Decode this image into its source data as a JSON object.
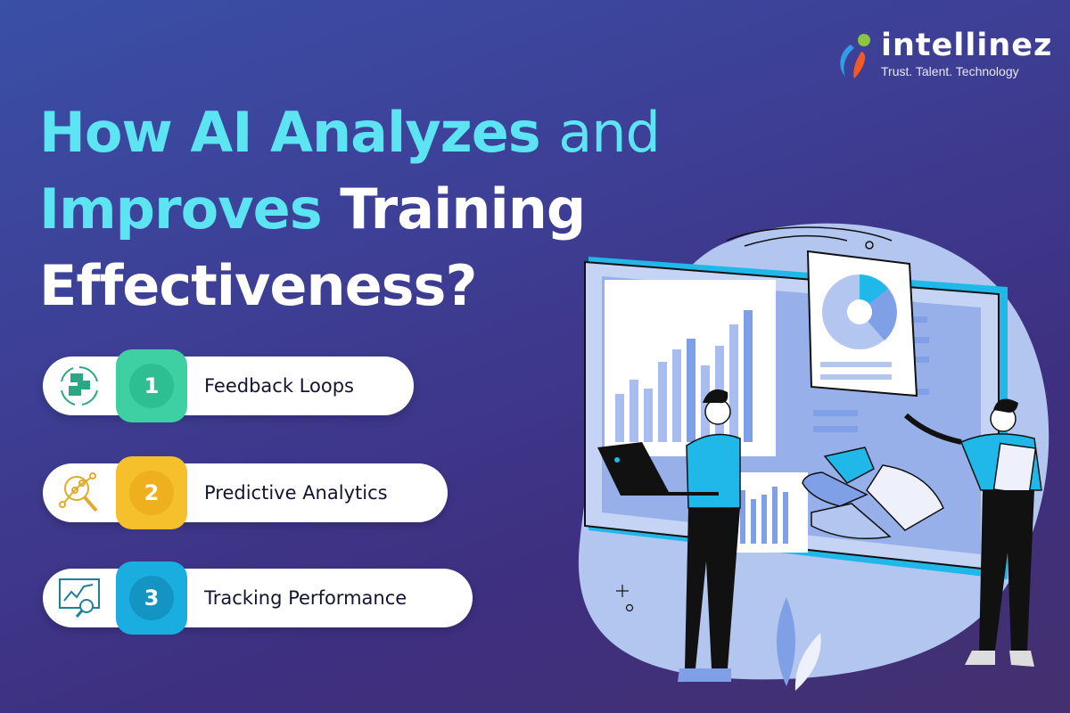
{
  "brand": {
    "name": "intellinez",
    "tagline": "Trust. Talent. Technology",
    "colors": {
      "blue": "#2e9ee6",
      "orange": "#f15a24",
      "green": "#8cc63f"
    }
  },
  "headline": {
    "line1_highlight": "How AI Analyzes",
    "line1_rest": "and",
    "line2_highlight": "Improves",
    "line2_rest": "Training",
    "line3": "Effectiveness?"
  },
  "items": [
    {
      "number": "1",
      "label": "Feedback Loops",
      "icon": "feedback-loop-icon",
      "color": "#3ecfa3",
      "inner": "#2fbd92"
    },
    {
      "number": "2",
      "label": "Predictive Analytics",
      "icon": "analytics-magnifier-icon",
      "color": "#f5c02c",
      "inner": "#eeb01c"
    },
    {
      "number": "3",
      "label": "Tracking Performance",
      "icon": "performance-chart-icon",
      "color": "#1aaee0",
      "inner": "#1494c3"
    }
  ],
  "colors": {
    "accent_cyan": "#5ce4f2",
    "bg_top": "#3a4fa6",
    "bg_bottom": "#44306f"
  }
}
